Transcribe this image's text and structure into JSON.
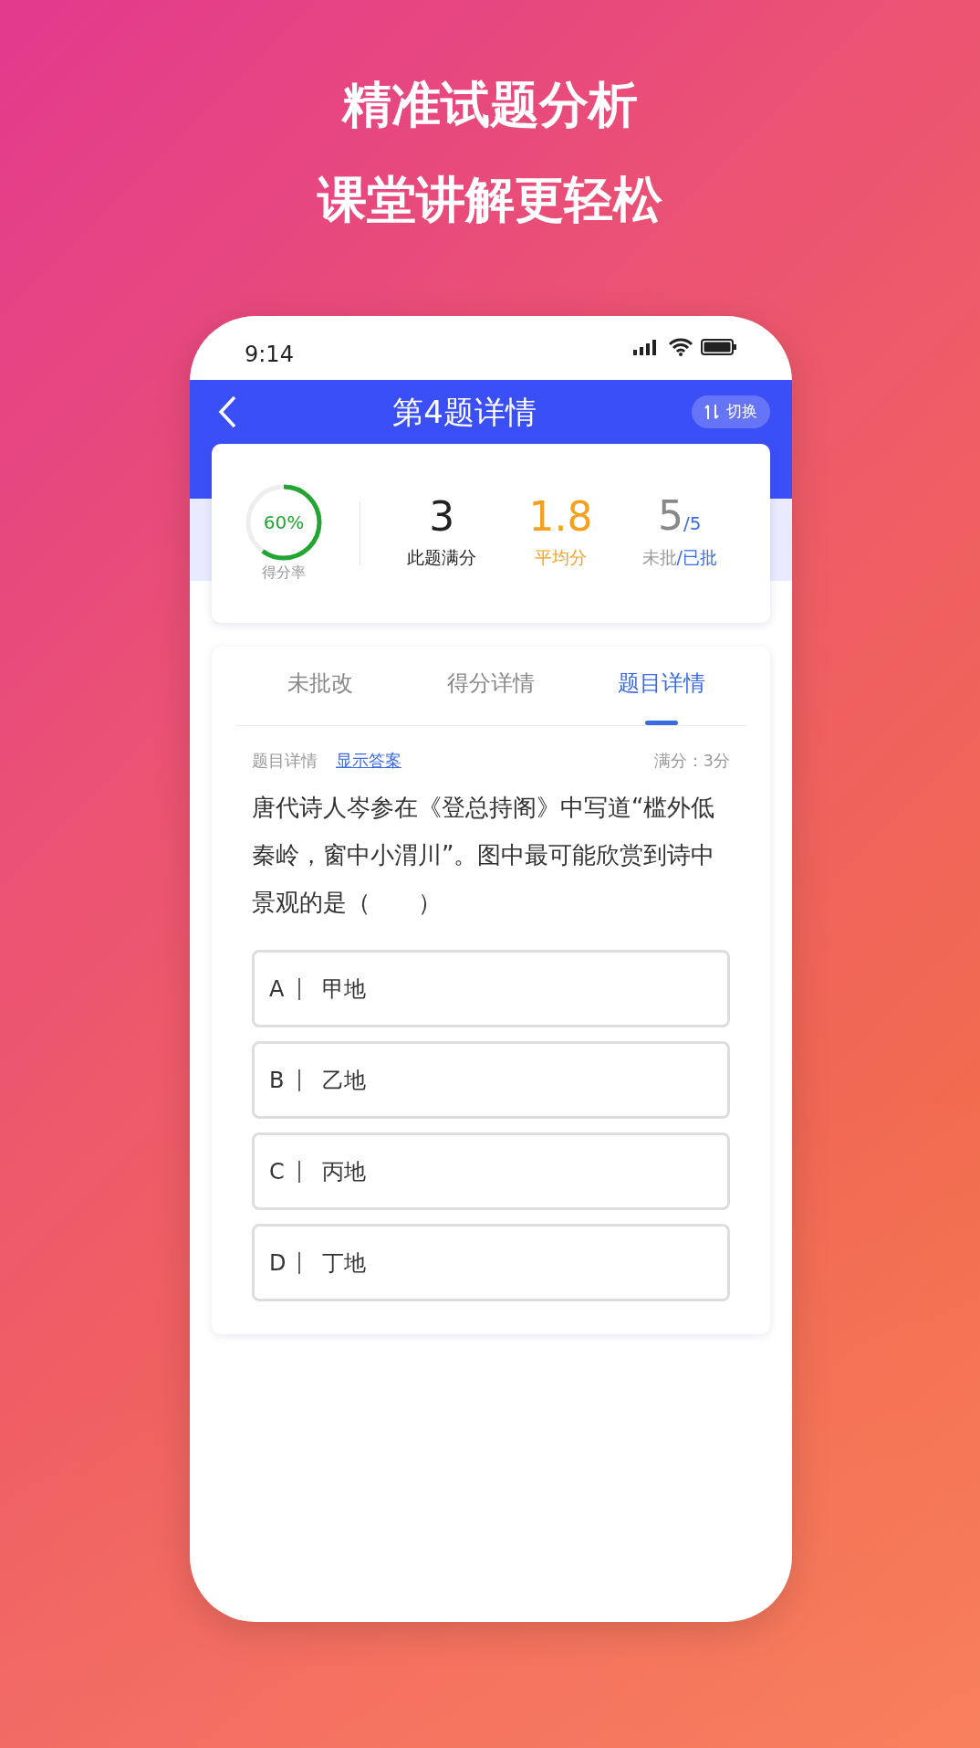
{
  "headlines": [
    "精准试题分析",
    "课堂讲解更轻松"
  ],
  "status_bar": {
    "time": "9:14"
  },
  "header": {
    "title": "第4题详情",
    "switch_label": "切换"
  },
  "stats": {
    "rate": {
      "value": "60%",
      "label": "得分率",
      "level": 0.6
    },
    "full_score": {
      "value": "3",
      "label": "此题满分"
    },
    "average": {
      "value": "1.8",
      "label": "平均分"
    },
    "marking": {
      "unmarked": "5",
      "marked": "/5",
      "unmarked_label": "未批",
      "marked_label": "/已批"
    }
  },
  "tabs": [
    {
      "label": "未批改",
      "selected": false
    },
    {
      "label": "得分详情",
      "selected": false
    },
    {
      "label": "题目详情",
      "selected": true
    }
  ],
  "question": {
    "section_label": "题目详情",
    "show_answer": "显示答案",
    "full_marks": "满分：3分",
    "text": "唐代诗人岑参在《登总持阁》中写道“槛外低秦岭，窗中小渭川”。图中最可能欣赏到诗中景观的是（　　）",
    "options": [
      {
        "letter": "A",
        "text": "甲地"
      },
      {
        "letter": "B",
        "text": "乙地"
      },
      {
        "letter": "C",
        "text": "丙地"
      },
      {
        "letter": "D",
        "text": "丁地"
      }
    ]
  }
}
